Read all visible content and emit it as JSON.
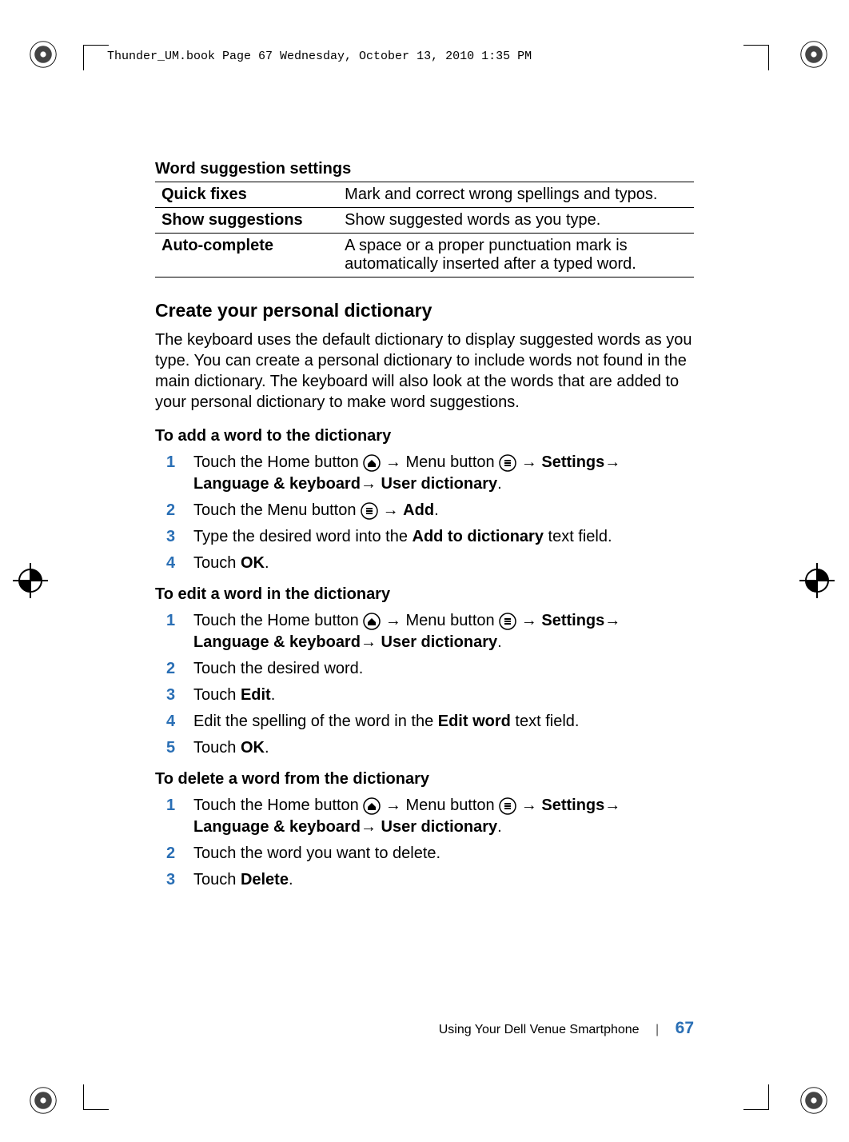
{
  "header_text": "Thunder_UM.book  Page 67  Wednesday, October 13, 2010  1:35 PM",
  "table_title": "Word suggestion settings",
  "table": [
    {
      "label": "Quick fixes",
      "desc": "Mark and correct wrong spellings and typos."
    },
    {
      "label": "Show suggestions",
      "desc": "Show suggested words as you type."
    },
    {
      "label": "Auto-complete",
      "desc": "A space or a proper punctuation mark is automatically inserted after a typed word."
    }
  ],
  "h2": "Create your personal dictionary",
  "para": "The keyboard uses the default dictionary to display suggested words as you type. You can create a personal dictionary to include words not found in the main dictionary. The keyboard will also look at the words that are added to your personal dictionary to make word suggestions.",
  "proc1": {
    "title": "To add a word to the dictionary",
    "steps": {
      "s1a": "Touch the Home button ",
      "s1b": "→ Menu button ",
      "s1c": "→ ",
      "s1d": "Settings",
      "s1e": "→ ",
      "s1f": "Language & keyboard",
      "s1g": "→ ",
      "s1h": "User dictionary",
      "s1i": ".",
      "s2a": "Touch the Menu button ",
      "s2b": "→ ",
      "s2c": "Add",
      "s2d": ".",
      "s3a": "Type the desired word into the ",
      "s3b": "Add to dictionary",
      "s3c": " text field.",
      "s4a": "Touch ",
      "s4b": "OK",
      "s4c": "."
    }
  },
  "proc2": {
    "title": "To edit a word in the dictionary",
    "steps": {
      "s1a": "Touch the Home button ",
      "s1b": "→ Menu button ",
      "s1c": "→ ",
      "s1d": "Settings",
      "s1e": "→ ",
      "s1f": "Language & keyboard",
      "s1g": "→ ",
      "s1h": "User dictionary",
      "s1i": ".",
      "s2": "Touch the desired word.",
      "s3a": "Touch ",
      "s3b": "Edit",
      "s3c": ".",
      "s4a": "Edit the spelling of the word in the ",
      "s4b": "Edit word",
      "s4c": " text field.",
      "s5a": "Touch ",
      "s5b": "OK",
      "s5c": "."
    }
  },
  "proc3": {
    "title": "To delete a word from the dictionary",
    "steps": {
      "s1a": "Touch the Home button ",
      "s1b": "→ Menu button ",
      "s1c": "→ ",
      "s1d": "Settings",
      "s1e": "→ ",
      "s1f": "Language & keyboard",
      "s1g": "→ ",
      "s1h": "User dictionary",
      "s1i": ".",
      "s2": "Touch the word you want to delete.",
      "s3a": "Touch ",
      "s3b": "Delete",
      "s3c": "."
    }
  },
  "footer_text": "Using Your Dell Venue Smartphone",
  "page_num": "67"
}
